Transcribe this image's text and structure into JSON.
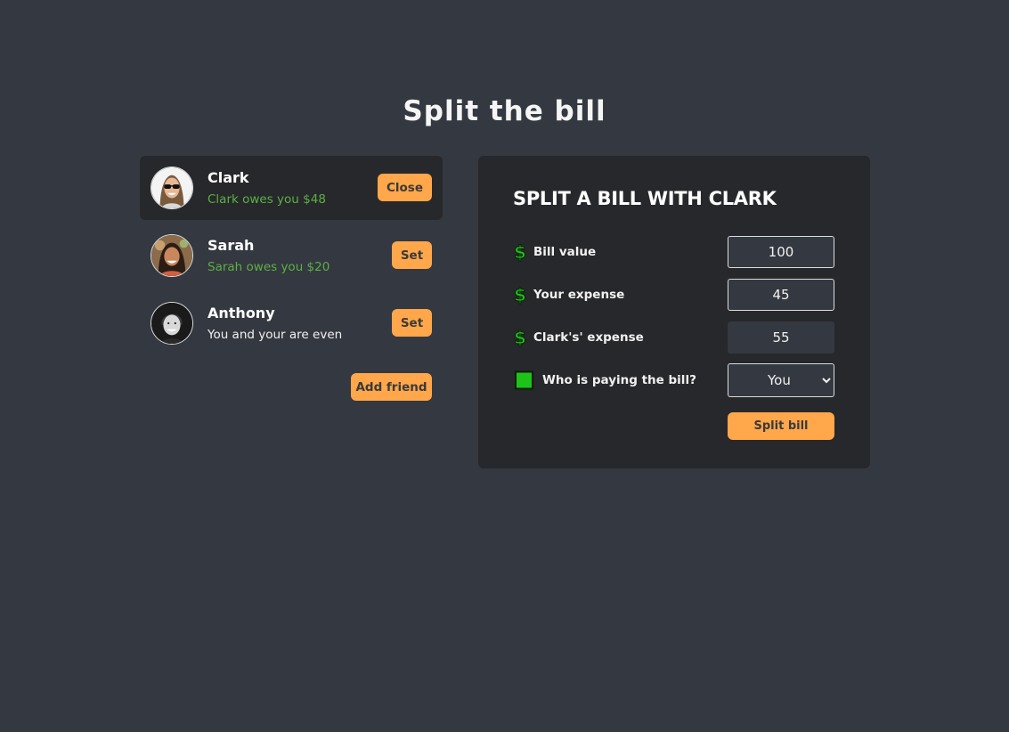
{
  "page": {
    "title": "Split the bill"
  },
  "friends": [
    {
      "name": "Clark",
      "status": "Clark owes you $48",
      "button": "Close",
      "selected": true,
      "avatar": "clark-avatar"
    },
    {
      "name": "Sarah",
      "status": "Sarah owes you $20",
      "button": "Set",
      "selected": false,
      "avatar": "sarah-avatar"
    },
    {
      "name": "Anthony",
      "status": "You and your are even",
      "button": "Set",
      "selected": false,
      "avatar": "anthony-avatar"
    }
  ],
  "add_friend_label": "Add friend",
  "split_form": {
    "title": "SPLIT A BILL WITH CLARK",
    "bill_value_label": "Bill value",
    "bill_value": "100",
    "your_expense_label": "Your expense",
    "your_expense": "45",
    "friend_expense_label": "Clark's' expense",
    "friend_expense": "55",
    "payer_label": "Who is paying the bill?",
    "payer_selected": "You",
    "submit_label": "Split bill"
  },
  "icons": {
    "bill_value": "dollar-icon",
    "your_expense": "dollar-icon",
    "friend_expense": "dollar-icon",
    "payer": "green-square-icon"
  },
  "colors": {
    "background": "#343840",
    "panel": "#27282b",
    "accent": "#ffa74a",
    "owes_text": "#5bb044",
    "dollar_icon": "#1ec31a"
  }
}
